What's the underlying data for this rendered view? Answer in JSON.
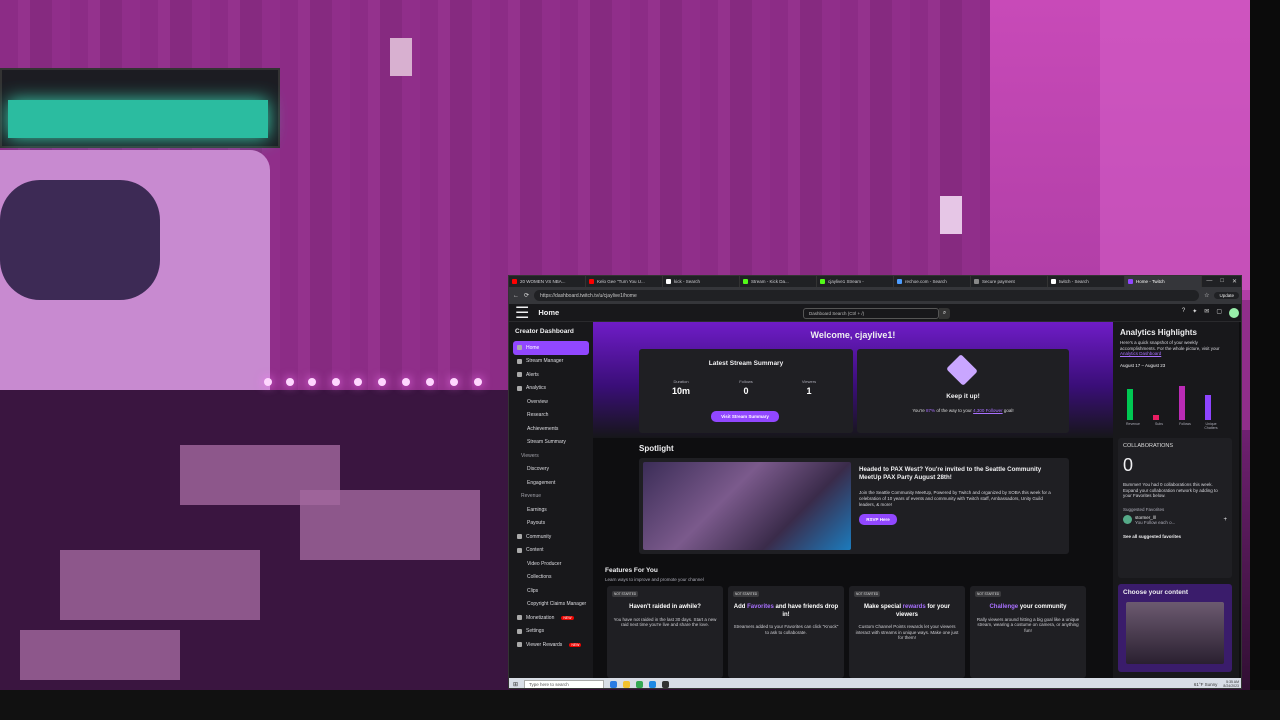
{
  "browser": {
    "tabs": [
      {
        "label": "20 WOMEN VS NBA...",
        "color": "#ff0000"
      },
      {
        "label": "Kelo Gee \"Turn You U...",
        "color": "#ff0000"
      },
      {
        "label": "kick - Search",
        "color": "#ffffff"
      },
      {
        "label": "Stream - Kick Da...",
        "color": "#53fc18"
      },
      {
        "label": "cjaylive1 Stream -",
        "color": "#53fc18"
      },
      {
        "label": "rechoe.com - Search",
        "color": "#4d9dff"
      },
      {
        "label": "Secure payment",
        "color": "#888888"
      },
      {
        "label": "twitch - Search",
        "color": "#ffffff"
      },
      {
        "label": "Home - Twitch",
        "color": "#9147ff"
      }
    ],
    "url": "https://dashboard.twitch.tv/u/cjaylive1/home",
    "update_label": "Update",
    "win_controls": [
      "—",
      "□",
      "✕"
    ]
  },
  "dashboard": {
    "page_title": "Home",
    "search_placeholder": "Dashboard Search (Ctrl + /)",
    "sidebar": {
      "header": "Creator Dashboard",
      "items": [
        {
          "label": "Home",
          "kind": "top",
          "active": true
        },
        {
          "label": "Stream Manager",
          "kind": "top"
        },
        {
          "label": "Alerts",
          "kind": "top"
        },
        {
          "label": "Analytics",
          "kind": "top"
        },
        {
          "label": "Overview",
          "kind": "sub"
        },
        {
          "label": "Research",
          "kind": "sub"
        },
        {
          "label": "Achievements",
          "kind": "sub"
        },
        {
          "label": "Stream Summary",
          "kind": "sub"
        },
        {
          "label": "Viewers",
          "kind": "grp"
        },
        {
          "label": "Discovery",
          "kind": "sub"
        },
        {
          "label": "Engagement",
          "kind": "sub"
        },
        {
          "label": "Revenue",
          "kind": "grp"
        },
        {
          "label": "Earnings",
          "kind": "sub"
        },
        {
          "label": "Payouts",
          "kind": "sub"
        },
        {
          "label": "Community",
          "kind": "top"
        },
        {
          "label": "Content",
          "kind": "top"
        },
        {
          "label": "Video Producer",
          "kind": "sub"
        },
        {
          "label": "Collections",
          "kind": "sub"
        },
        {
          "label": "Clips",
          "kind": "sub"
        },
        {
          "label": "Copyright Claims Manager",
          "kind": "sub"
        },
        {
          "label": "Monetization",
          "kind": "top",
          "badge": "NEW"
        },
        {
          "label": "Settings",
          "kind": "top"
        },
        {
          "label": "Viewer Rewards",
          "kind": "top",
          "badge": "NEW"
        }
      ]
    },
    "welcome": "Welcome, cjaylive1!",
    "latest": {
      "title": "Latest Stream Summary",
      "stats": [
        {
          "label": "Duration",
          "value": "10m"
        },
        {
          "label": "Follows",
          "value": "0"
        },
        {
          "label": "Viewers",
          "value": "1"
        }
      ],
      "button": "Visit Stream Summary"
    },
    "keepup": {
      "title": "Keep it up!",
      "text_pre": "You're",
      "pct": "87%",
      "text_mid": "of the way to your",
      "goal": "4,300 Follower",
      "text_post": "goal!"
    },
    "spotlight": {
      "heading": "Spotlight",
      "title": "Headed to PAX West? You're invited to the Seattle Community MeetUp PAX Party August 28th!",
      "body": "Join the Seattle Community MeetUp, Powered by Twitch and organized by SOBA this week for a celebration of 10 years of events and community with Twitch staff, Ambassadors, Unity Guild leaders, & more!",
      "button": "RSVP Here"
    },
    "features": {
      "heading": "Features For You",
      "subheading": "Learn ways to improve and promote your channel",
      "cards": [
        {
          "status": "NOT STARTED",
          "title": "Haven't raided in awhile?",
          "desc": "You have not raided in the last 30 days. Start a new raid next time you're live and share the love."
        },
        {
          "status": "NOT STARTED",
          "title_pre": "Add",
          "title_hl": "Favorites",
          "title": "and have friends drop in!",
          "desc": "Streamers added to your Favorites can click \"Knock\" to ask to collaborate."
        },
        {
          "status": "NOT STARTED",
          "title_pre": "Make special",
          "title_hl": "rewards",
          "title": "for your viewers",
          "desc": "Custom Channel Points rewards let your viewers interact with streams in unique ways. Make one just for them!"
        },
        {
          "status": "NOT STARTED",
          "title_hl": "Challenge",
          "title": "your community",
          "desc": "Rally viewers around hitting a big goal like a unique stream, wearing a costume on camera, or anything fun!"
        }
      ]
    },
    "analytics": {
      "title": "Analytics Highlights",
      "desc_pre": "Here's a quick snapshot of your weekly accomplishments. For the whole picture, visit your",
      "link": "Analytics Dashboard",
      "range": "August 17 – August 23",
      "labels": [
        "Revenue",
        "Subs",
        "Follows",
        "Unique Chatters"
      ],
      "bar_values": [
        0.85,
        0.15,
        0.95,
        0.7
      ],
      "colors": [
        "#00c853",
        "#e91e63",
        "#bb2bb6",
        "#8e44ff"
      ]
    },
    "collab": {
      "title": "COLLABORATIONS",
      "count": "0",
      "text": "Bummer! You had 0 collaborations this week. Expand your collaboration network by adding to your Favorites below.",
      "suggested_label": "Suggested Favorites",
      "suggested_name": "stormer_lll",
      "suggested_sub": "You Follow each o...",
      "see_all": "See all suggested favorites"
    },
    "choose": {
      "title": "Choose your content"
    }
  },
  "taskbar": {
    "search_placeholder": "Type here to search",
    "weather": "61°F Sunny",
    "time": "5:35 AM",
    "date": "8/24/2023"
  }
}
